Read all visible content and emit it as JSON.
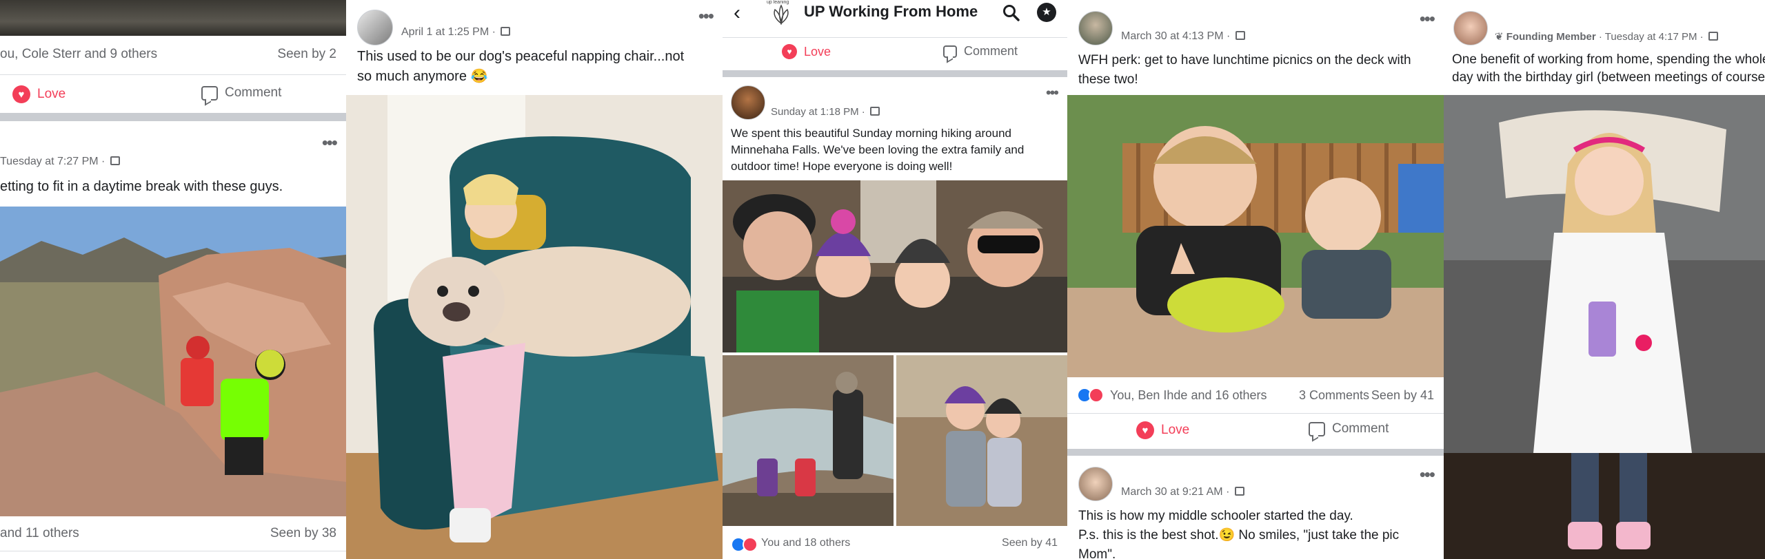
{
  "panel1": {
    "top_reactions": "ou, Cole Sterr and 9 others",
    "top_seen": "Seen by 2",
    "love_label": "Love",
    "comment_label": "Comment",
    "post_meta": "Tuesday at 7:27 PM · ",
    "post_text": "etting to fit in a daytime break with these guys.",
    "bottom_reactions": "and 11 others",
    "bottom_seen": "Seen by 38"
  },
  "panel2": {
    "post_meta": "April 1 at 1:25 PM · ",
    "post_text": "This used to be our dog's peaceful napping chair...not so much anymore 😂"
  },
  "panel3": {
    "group_title": "UP Working From Home",
    "logo_caption": "up leaning",
    "love_label": "Love",
    "comment_label": "Comment",
    "post_meta": "Sunday at 1:18 PM · ",
    "post_text": "We spent this beautiful Sunday morning hiking around Minnehaha Falls. We've been loving the extra family and outdoor time! Hope everyone is doing well!",
    "reactions": "You and 18 others",
    "seen": "Seen by 41"
  },
  "panel4": {
    "post_meta": "March 30 at 4:13 PM · ",
    "post_text": "WFH perk: get to have lunchtime picnics on the deck with these two!",
    "reactions": "You, Ben Ihde and 16 others",
    "comments": "3 Comments",
    "seen": "Seen by 41",
    "love_label": "Love",
    "comment_label": "Comment",
    "post2_meta": "March 30 at 9:21 AM · ",
    "post2_line1": "This is how my middle schooler started the day.",
    "post2_line2": "P.s. this is the best shot.😉 No smiles, \"just take the pic Mom\"."
  },
  "panel5": {
    "badge": "Founding Member",
    "post_meta": " · Tuesday at 4:17 PM · ",
    "post_text": "One benefit of working from home, spending the whole day with the birthday girl (between meetings of course)."
  }
}
